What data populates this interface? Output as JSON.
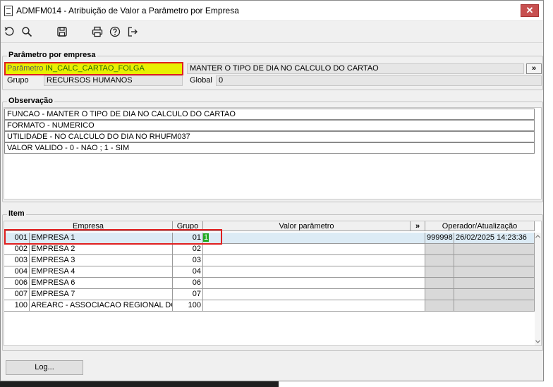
{
  "window": {
    "title": "ADMFM014 - Atribuição de Valor a Parâmetro por Empresa",
    "close_label": "✕"
  },
  "toolbar": {
    "icons": [
      "undo-icon",
      "search-icon",
      "save-icon",
      "print-icon",
      "help-icon",
      "exit-icon"
    ]
  },
  "param_section": {
    "legend": "Parâmetro por empresa",
    "param_label": "Parâmetro",
    "param_value": "IN_CALC_CARTAO_FOLGA",
    "param_description": "MANTER O TIPO DE DIA NO CALCULO DO CARTAO",
    "expand_label": "»",
    "group_label": "Grupo",
    "group_value": "RECURSOS HUMANOS",
    "global_label": "Global",
    "global_value": "0"
  },
  "observacao": {
    "legend": "Observação",
    "lines": [
      "FUNCAO - MANTER O TIPO DE DIA NO CALCULO DO CARTAO",
      "FORMATO - NUMERICO",
      "UTILIDADE - NO CALCULO DO DIA NO RHUFM037",
      "VALOR VALIDO -  0 - NAO  ; 1 - SIM"
    ]
  },
  "item": {
    "legend": "Item",
    "headers": {
      "empresa": "Empresa",
      "grupo": "Grupo",
      "valor": "Valor parâmetro",
      "more": "»",
      "operador": "Operador/Atualização"
    },
    "rows": [
      {
        "code": "001",
        "name": "EMPRESA 1",
        "grupo": "01",
        "valor": "1",
        "operador": "999998",
        "atualizacao": "26/02/2025 14:23:36"
      },
      {
        "code": "002",
        "name": "EMPRESA 2",
        "grupo": "02",
        "valor": "",
        "operador": "",
        "atualizacao": ""
      },
      {
        "code": "003",
        "name": "EMPRESA 3",
        "grupo": "03",
        "valor": "",
        "operador": "",
        "atualizacao": ""
      },
      {
        "code": "004",
        "name": "EMPRESA 4",
        "grupo": "04",
        "valor": "",
        "operador": "",
        "atualizacao": ""
      },
      {
        "code": "006",
        "name": "EMPRESA 6",
        "grupo": "06",
        "valor": "",
        "operador": "",
        "atualizacao": ""
      },
      {
        "code": "007",
        "name": "EMPRESA 7",
        "grupo": "07",
        "valor": "",
        "operador": "",
        "atualizacao": ""
      },
      {
        "code": "100",
        "name": "AREARC - ASSOCIACAO REGIONAL DOS",
        "grupo": "100",
        "valor": "",
        "operador": "",
        "atualizacao": ""
      }
    ]
  },
  "footer": {
    "log_label": "Log..."
  },
  "colors": {
    "highlight_fill": "#e8f000",
    "highlight_border": "#e02020",
    "selected_row": "#dcebf5",
    "value_cell": "#22aa22"
  }
}
